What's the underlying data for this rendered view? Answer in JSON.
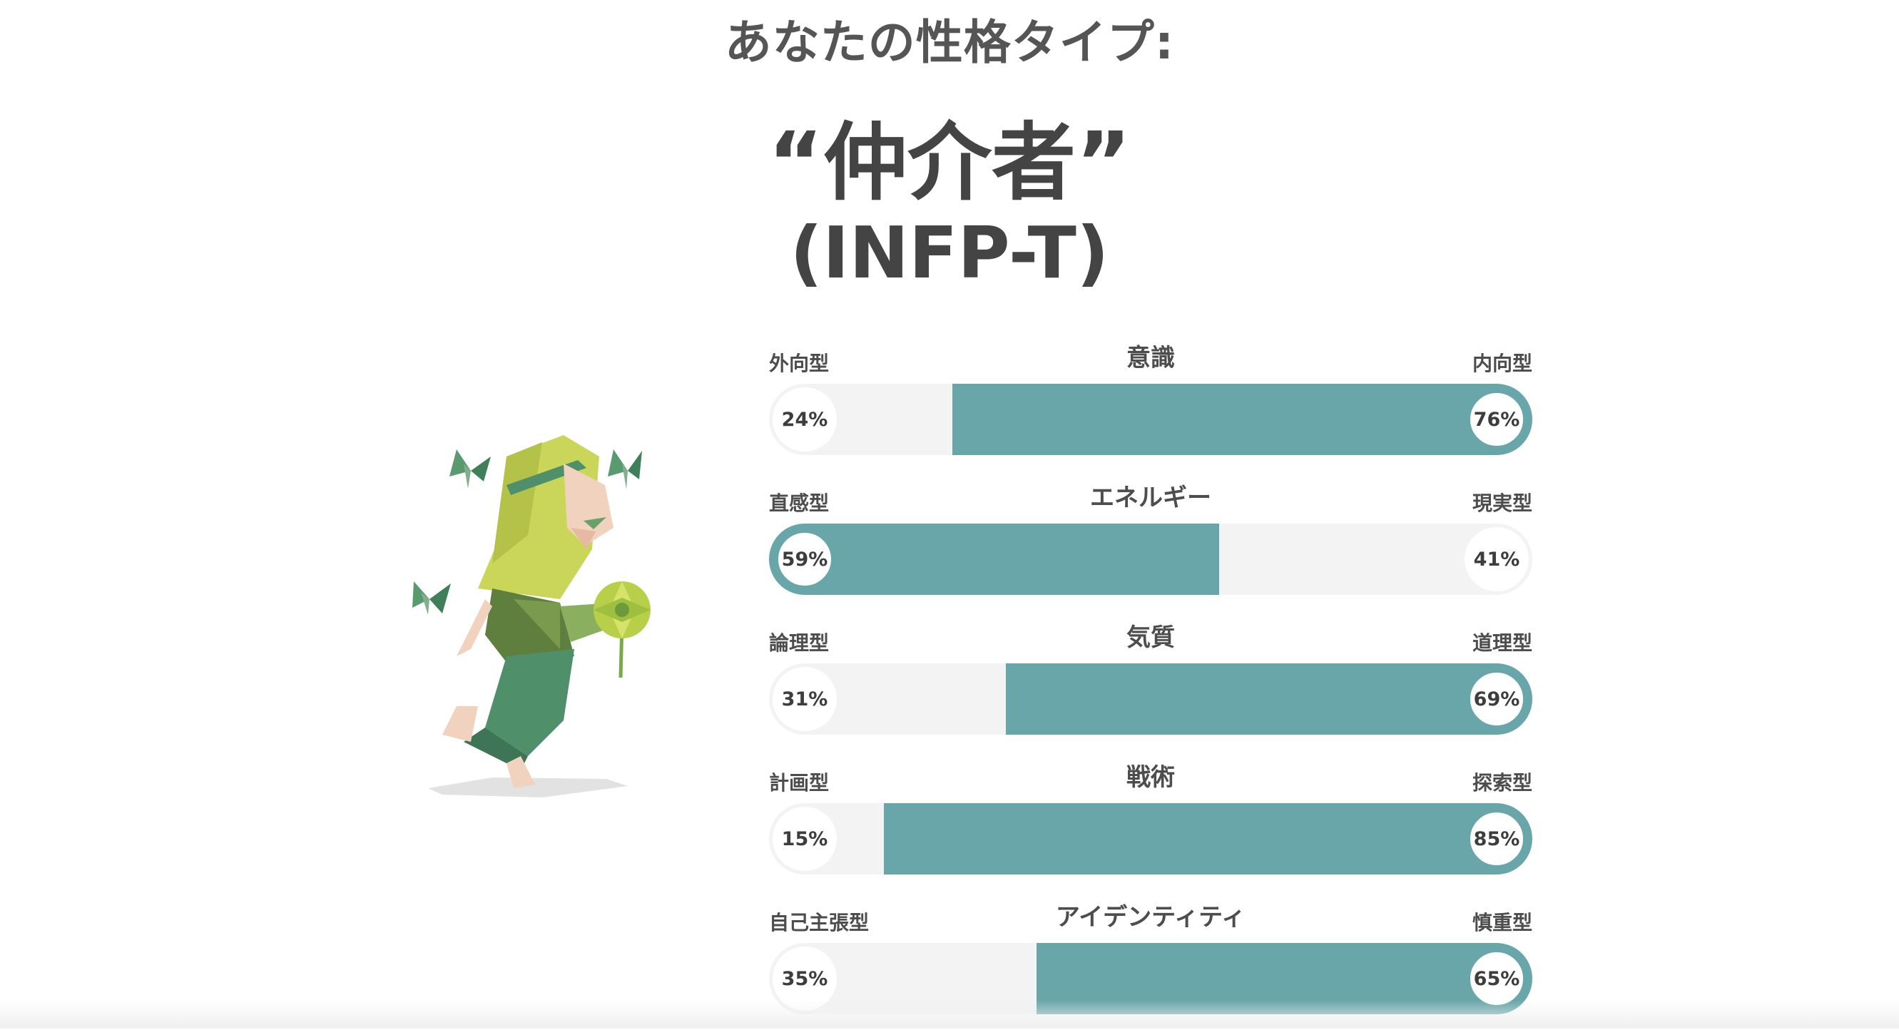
{
  "header": {
    "subtitle": "あなたの性格タイプ:",
    "title": "“仲介者”",
    "code": "(INFP-T)"
  },
  "colors": {
    "accent": "#68a6aa",
    "track": "#f3f3f3",
    "text": "#4a4a4a"
  },
  "illustration": {
    "icon": "mediator-character-illustration"
  },
  "scales": [
    {
      "title": "意識",
      "left_label": "外向型",
      "right_label": "内向型",
      "left_pct": "24%",
      "right_pct": "76%",
      "left_value": 24,
      "right_value": 76,
      "dominant": "right"
    },
    {
      "title": "エネルギー",
      "left_label": "直感型",
      "right_label": "現実型",
      "left_pct": "59%",
      "right_pct": "41%",
      "left_value": 59,
      "right_value": 41,
      "dominant": "left"
    },
    {
      "title": "気質",
      "left_label": "論理型",
      "right_label": "道理型",
      "left_pct": "31%",
      "right_pct": "69%",
      "left_value": 31,
      "right_value": 69,
      "dominant": "right"
    },
    {
      "title": "戦術",
      "left_label": "計画型",
      "right_label": "探索型",
      "left_pct": "15%",
      "right_pct": "85%",
      "left_value": 15,
      "right_value": 85,
      "dominant": "right"
    },
    {
      "title": "アイデンティティ",
      "left_label": "自己主張型",
      "right_label": "慎重型",
      "left_pct": "35%",
      "right_pct": "65%",
      "left_value": 35,
      "right_value": 65,
      "dominant": "right"
    }
  ]
}
